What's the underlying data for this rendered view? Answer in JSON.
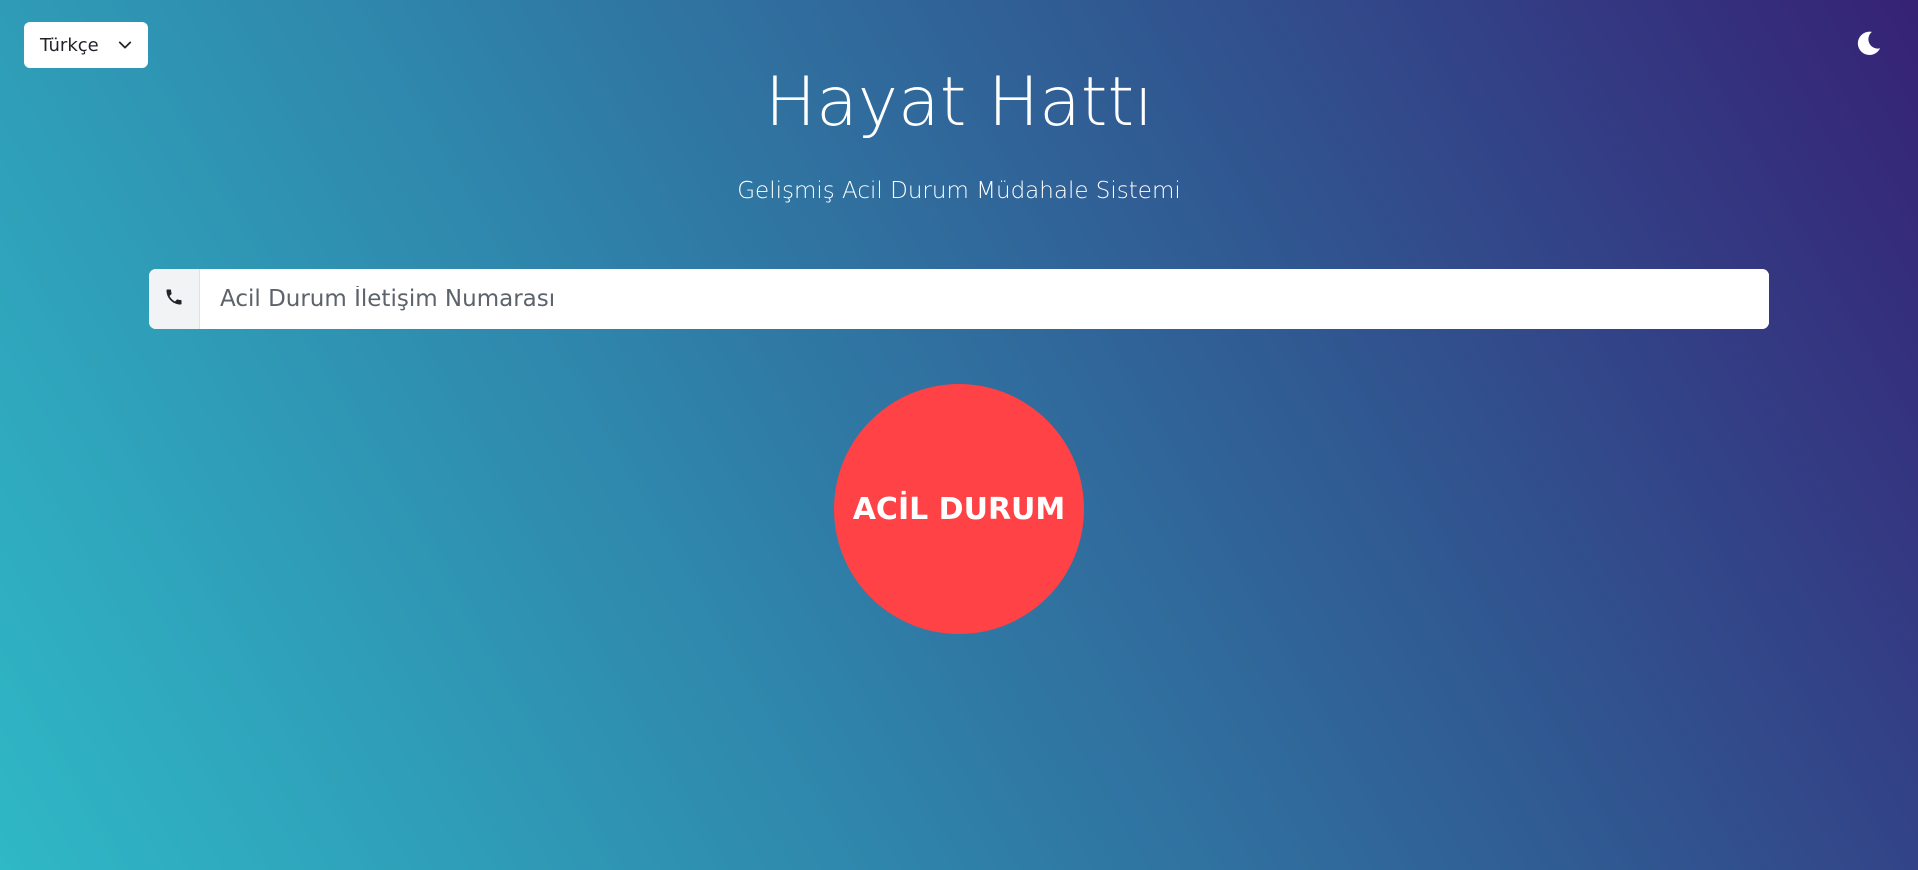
{
  "language": {
    "selected": "Türkçe"
  },
  "header": {
    "title": "Hayat Hattı",
    "subtitle": "Gelişmiş Acil Durum Müdahale Sistemi"
  },
  "phone": {
    "icon": "phone-icon",
    "placeholder": "Acil Durum İletişim Numarası",
    "value": ""
  },
  "emergency": {
    "label": "ACİL DURUM"
  },
  "theme": {
    "icon": "moon-icon"
  },
  "colors": {
    "emergency_red": "#fe4245",
    "gradient_start": "#2fb8c6",
    "gradient_end": "#362276"
  }
}
